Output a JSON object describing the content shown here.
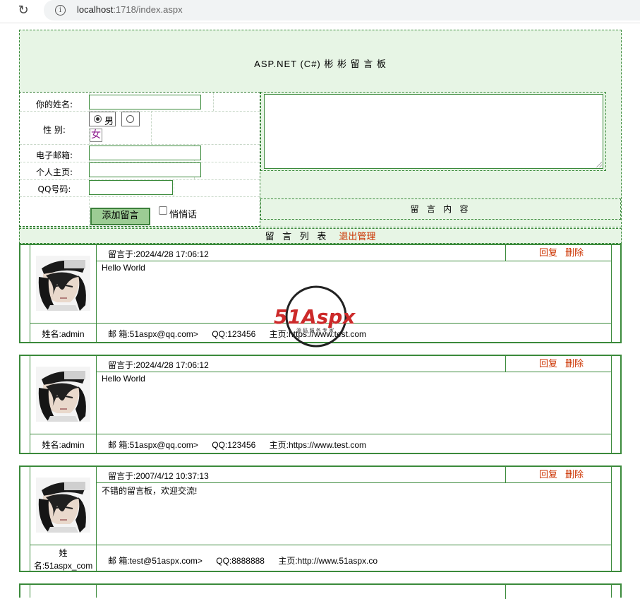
{
  "browser": {
    "host": "localhost",
    "path": ":1718/index.aspx"
  },
  "board": {
    "title": "ASP.NET (C#) 彬 彬 留 言 板"
  },
  "form": {
    "name_label": "你的姓名:",
    "gender_label": "性  别:",
    "gender_male": "男",
    "gender_female": "女",
    "email_label": "电子邮箱:",
    "homepage_label": "个人主页:",
    "qq_label": "QQ号码:",
    "submit_label": "添加留言",
    "whisper_label": "悄悄话",
    "content_label": "留 言 内 容"
  },
  "list": {
    "title": "留 言 列 表",
    "logout_label": "退出管理"
  },
  "messages": [
    {
      "time": "留言于:2024/4/28 17:06:12",
      "reply": "回复",
      "delete": "删除",
      "body": "Hello World",
      "name": "姓名:admin",
      "email": "邮 箱:51aspx@qq.com>",
      "qq": "QQ:123456",
      "home": "主页:https://www.test.com"
    },
    {
      "time": "留言于:2024/4/28 17:06:12",
      "reply": "回复",
      "delete": "删除",
      "body": "Hello World",
      "name": "姓名:admin",
      "email": "邮 箱:51aspx@qq.com>",
      "qq": "QQ:123456",
      "home": "主页:https://www.test.com"
    },
    {
      "time": "留言于:2007/4/12 10:37:13",
      "reply": "回复",
      "delete": "删除",
      "body": "不错的留言板，欢迎交流!",
      "name_a": "姓",
      "name_b": "名:51aspx_com",
      "email": "邮 箱:test@51aspx.com>",
      "qq": "QQ:8888888",
      "home": "主页:http://www.51aspx.co"
    }
  ],
  "watermark": {
    "brand": "51Aspx",
    "tagline": "源 码 服 务 专 家"
  },
  "icons": {
    "reload": "reload-icon",
    "info": "info-icon",
    "avatar": "avatar-image",
    "logo": "51aspx-logo"
  },
  "colors": {
    "border": "#3b8a3b",
    "panel": "#e7f5e5",
    "link": "#cc3300",
    "button": "#9ccc94"
  }
}
